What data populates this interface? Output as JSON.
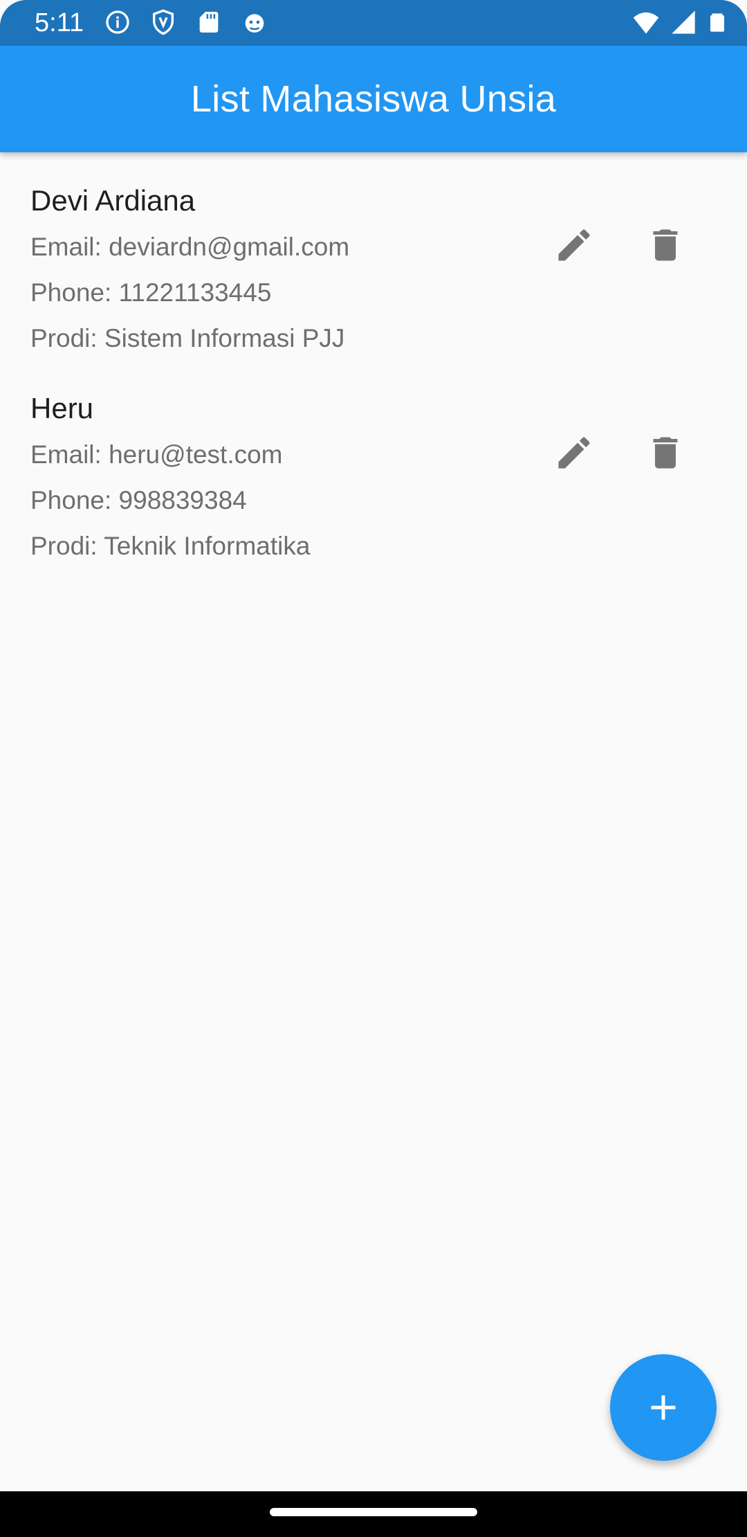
{
  "status_bar": {
    "time": "5:11",
    "left_icons": [
      "info-icon",
      "shield-icon",
      "sd-card-icon",
      "android-debug-icon"
    ],
    "right_icons": [
      "wifi-icon",
      "signal-icon",
      "battery-icon"
    ],
    "color": "#1e74bb"
  },
  "app_bar": {
    "title": "List Mahasiswa Unsia",
    "color": "#2196f3"
  },
  "students": [
    {
      "name": "Devi Ardiana",
      "email": "Email: deviardn@gmail.com",
      "phone": "Phone: 11221133445",
      "prodi": "Prodi: Sistem Informasi PJJ",
      "edit_icon": "pencil-icon",
      "delete_icon": "trash-icon"
    },
    {
      "name": "Heru",
      "email": "Email: heru@test.com",
      "phone": "Phone: 998839384",
      "prodi": "Prodi: Teknik Informatika",
      "edit_icon": "pencil-icon",
      "delete_icon": "trash-icon"
    }
  ],
  "fab": {
    "icon": "plus-icon",
    "color": "#2196f3"
  }
}
